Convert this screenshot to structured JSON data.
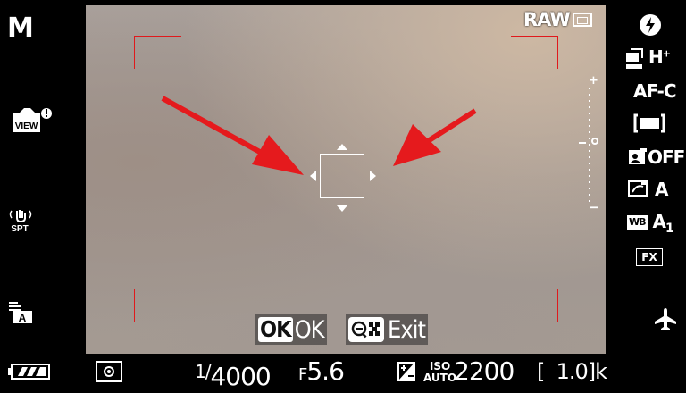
{
  "shooting_mode": "M",
  "viewfinder": {
    "raw_label": "RAW",
    "ok_button": {
      "key": "OK",
      "label": "OK"
    },
    "exit_button": {
      "label": "Exit"
    }
  },
  "left_panel": {
    "view_icon": "view-mode-warning-icon",
    "view_label": "VIEW",
    "vr_label": "SPT",
    "picture_label": "A"
  },
  "right_panel": {
    "release_mode": "H",
    "release_sup": "+",
    "af_mode": "AF-C",
    "adl": "OFF",
    "picture_control": "A",
    "wb_label": "WB",
    "wb_value": "A",
    "wb_sub": "1",
    "image_area": "FX",
    "exposure_scale_plus": "+",
    "exposure_scale_minus": "−"
  },
  "bottom_bar": {
    "shutter_num": "1/",
    "shutter_den": "4000",
    "aperture_prefix": "F",
    "aperture": "5.6",
    "iso_label": "ISO",
    "iso_auto": "AUTO",
    "iso": "2200",
    "shots_remaining": "[  1.0]k"
  },
  "colors": {
    "focus_frame": "#e0191c",
    "annotation_arrow": "#e51a1d"
  }
}
